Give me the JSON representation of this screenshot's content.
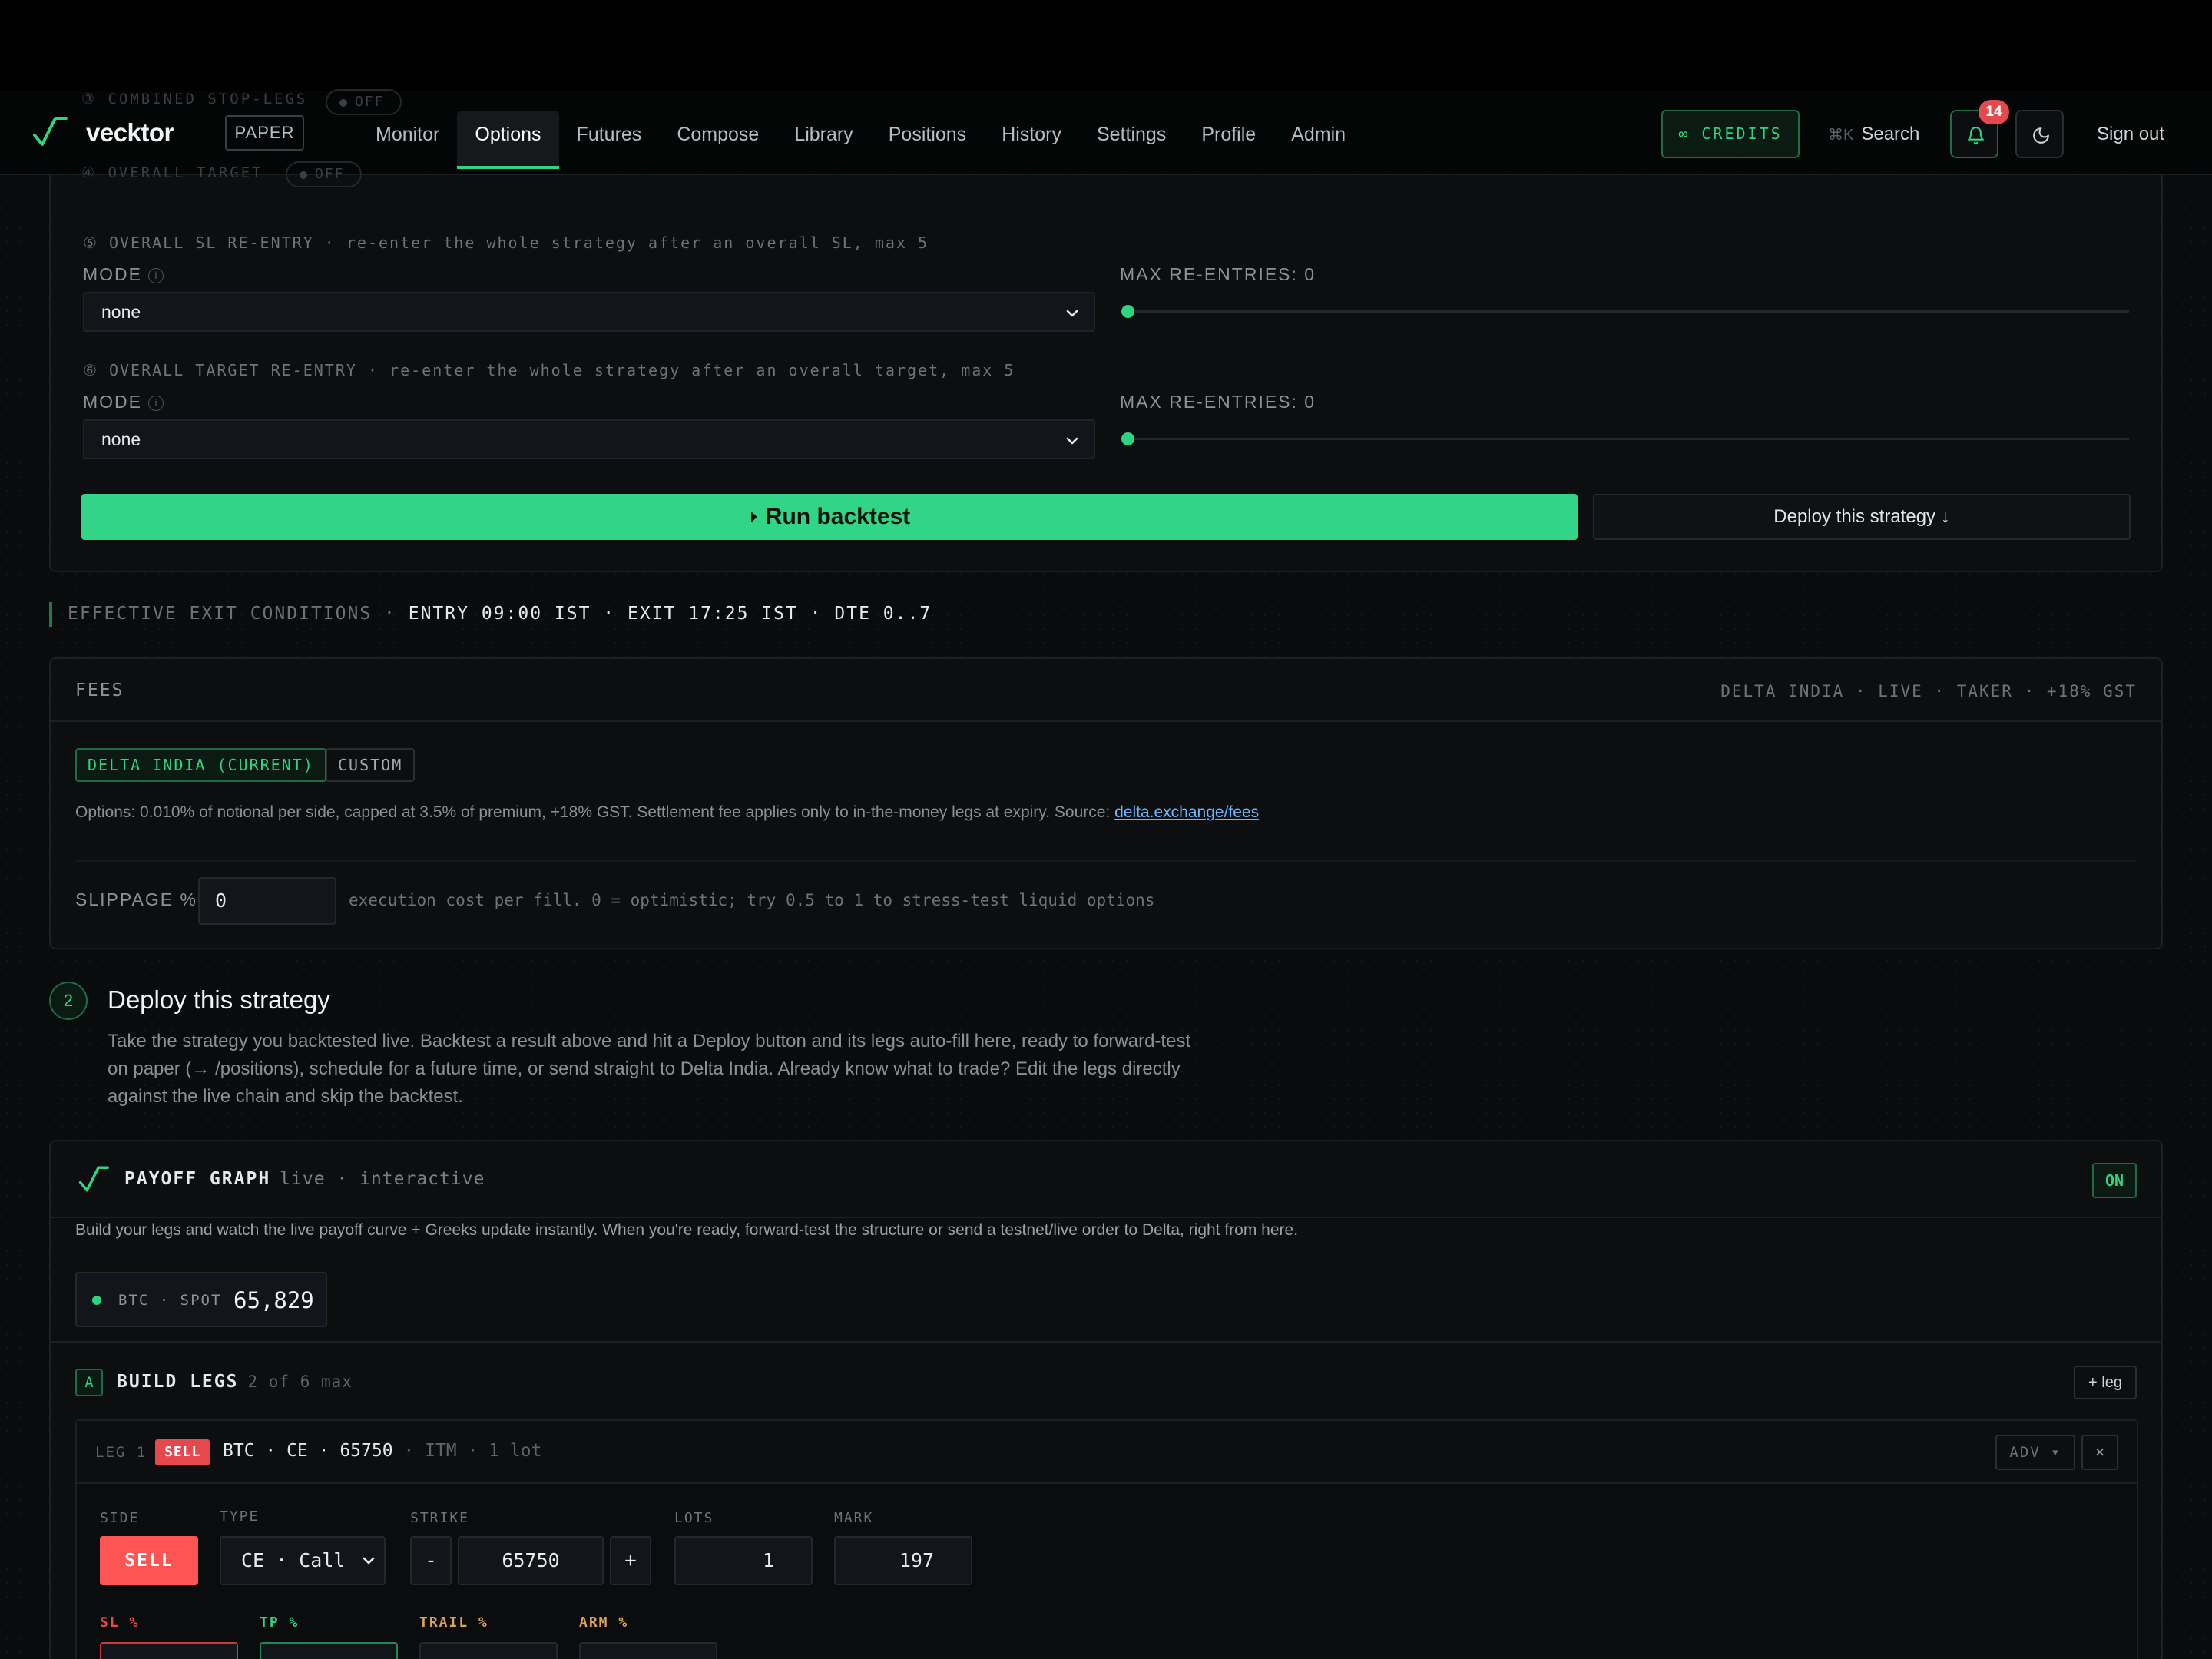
{
  "header": {
    "brand": "vecktor",
    "mode_badge": "PAPER",
    "nav": [
      "Monitor",
      "Options",
      "Futures",
      "Compose",
      "Library",
      "Positions",
      "History",
      "Settings",
      "Profile",
      "Admin"
    ],
    "active_nav": "Options",
    "credits_label": "∞ CREDITS",
    "search_kbd": "⌘K",
    "search_label": "Search",
    "notification_count": "14",
    "signout_label": "Sign out",
    "accent_color": "#2fd483"
  },
  "behind_header": {
    "combined_stop_legs": "③ COMBINED STOP-LEGS",
    "combined_stop_legs_state": "OFF",
    "overall_target": "④ OVERALL TARGET",
    "overall_target_state": "OFF"
  },
  "reentry": {
    "sl": {
      "title": "⑤ OVERALL SL RE-ENTRY · re-enter the whole strategy after an overall SL, max 5",
      "mode_label": "MODE",
      "mode_value": "none",
      "max_label": "MAX RE-ENTRIES: 0",
      "max_value": 0,
      "max_limit": 5
    },
    "target": {
      "title": "⑥ OVERALL TARGET RE-ENTRY · re-enter the whole strategy after an overall target, max 5",
      "mode_label": "MODE",
      "mode_value": "none",
      "max_label": "MAX RE-ENTRIES: 0",
      "max_value": 0,
      "max_limit": 5
    },
    "run_label": "Run backtest",
    "deploy_label": "Deploy this strategy ↓"
  },
  "effective_exit": {
    "label": "EFFECTIVE EXIT CONDITIONS ·",
    "value": "ENTRY 09:00 IST · EXIT 17:25 IST · DTE 0..7"
  },
  "fees": {
    "title": "FEES",
    "meta": "DELTA INDIA · LIVE · TAKER · +18% GST",
    "preset_active": "DELTA INDIA (CURRENT)",
    "preset_custom": "CUSTOM",
    "description": "Options: 0.010% of notional per side, capped at 3.5% of premium, +18% GST. Settlement fee applies only to in-the-money legs at expiry. Source:",
    "source_link": "delta.exchange/fees",
    "slippage_label": "SLIPPAGE %",
    "slippage_value": "0",
    "slippage_hint": "execution cost per fill. 0 = optimistic; try 0.5 to 1 to stress-test liquid options"
  },
  "deploy": {
    "step": "2",
    "title": "Deploy this strategy",
    "description": "Take the strategy you backtested live. Backtest a result above and hit a Deploy button and its legs auto-fill here, ready to forward-test on paper (→ /positions), schedule for a future time, or send straight to Delta India. Already know what to trade? Edit the legs directly against the live chain and skip the backtest."
  },
  "payoff": {
    "title": "PAYOFF GRAPH",
    "subtitle": "live · interactive",
    "status": "ON",
    "description": "Build your legs and watch the live payoff curve + Greeks update instantly. When you're ready, forward-test the structure or send a testnet/live order to Delta, right from here.",
    "spot_label": "BTC · SPOT",
    "spot_value": "65,829",
    "build_badge": "A",
    "build_title": "BUILD LEGS",
    "build_count": "2 of 6 max",
    "add_leg_label": "+ leg",
    "legs": [
      {
        "label": "LEG 1",
        "side_pill": "SELL",
        "summary": "BTC · CE · 65750",
        "summary_dim": " · ITM · 1 lot",
        "adv_label": "ADV ▾",
        "close_label": "×",
        "side_label": "SIDE",
        "side_value": "SELL",
        "type_label": "TYPE",
        "type_value": "CE · Call",
        "strike_label": "STRIKE",
        "strike_value": "65750",
        "minus": "-",
        "plus": "+",
        "lots_label": "LOTS",
        "lots_value": "1",
        "mark_label": "MARK",
        "mark_value": "197",
        "sl_label": "SL %",
        "tp_label": "TP %",
        "trail_label": "TRAIL %",
        "arm_label": "ARM %"
      }
    ]
  }
}
